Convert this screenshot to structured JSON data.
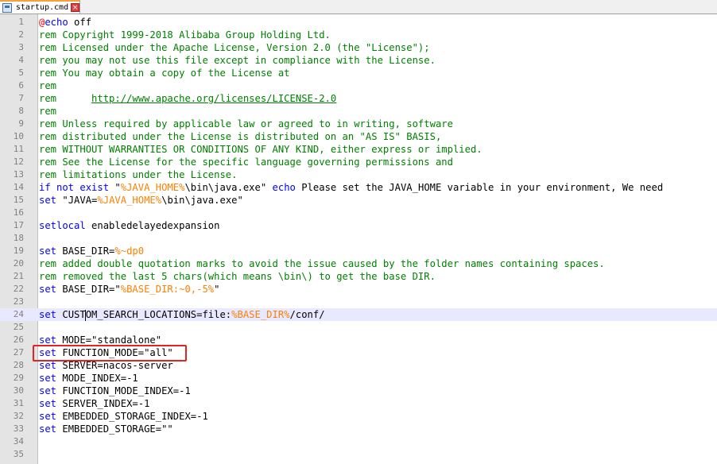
{
  "tab": {
    "filename": "startup.cmd",
    "close_glyph": "×",
    "icon": "file-icon"
  },
  "editor": {
    "current_line": 24,
    "lines": [
      {
        "n": "1",
        "segs": [
          {
            "c": "at",
            "t": "@"
          },
          {
            "c": "kw",
            "t": "echo"
          },
          {
            "c": "",
            "t": " off"
          }
        ]
      },
      {
        "n": "2",
        "segs": [
          {
            "c": "rem",
            "t": "rem Copyright 1999-2018 Alibaba Group Holding Ltd."
          }
        ]
      },
      {
        "n": "3",
        "segs": [
          {
            "c": "rem",
            "t": "rem Licensed under the Apache License, Version 2.0 (the \"License\");"
          }
        ]
      },
      {
        "n": "4",
        "segs": [
          {
            "c": "rem",
            "t": "rem you may not use this file except in compliance with the License."
          }
        ]
      },
      {
        "n": "5",
        "segs": [
          {
            "c": "rem",
            "t": "rem You may obtain a copy of the License at"
          }
        ]
      },
      {
        "n": "6",
        "segs": [
          {
            "c": "rem",
            "t": "rem"
          }
        ]
      },
      {
        "n": "7",
        "segs": [
          {
            "c": "rem",
            "t": "rem      "
          },
          {
            "c": "url",
            "t": "http://www.apache.org/licenses/LICENSE-2.0"
          }
        ]
      },
      {
        "n": "8",
        "segs": [
          {
            "c": "rem",
            "t": "rem"
          }
        ]
      },
      {
        "n": "9",
        "segs": [
          {
            "c": "rem",
            "t": "rem Unless required by applicable law or agreed to in writing, software"
          }
        ]
      },
      {
        "n": "10",
        "segs": [
          {
            "c": "rem",
            "t": "rem distributed under the License is distributed on an \"AS IS\" BASIS,"
          }
        ]
      },
      {
        "n": "11",
        "segs": [
          {
            "c": "rem",
            "t": "rem WITHOUT WARRANTIES OR CONDITIONS OF ANY KIND, either express or implied."
          }
        ]
      },
      {
        "n": "12",
        "segs": [
          {
            "c": "rem",
            "t": "rem See the License for the specific language governing permissions and"
          }
        ]
      },
      {
        "n": "13",
        "segs": [
          {
            "c": "rem",
            "t": "rem limitations under the License."
          }
        ]
      },
      {
        "n": "14",
        "segs": [
          {
            "c": "kw",
            "t": "if not exist"
          },
          {
            "c": "",
            "t": " \""
          },
          {
            "c": "var",
            "t": "%JAVA_HOME%"
          },
          {
            "c": "",
            "t": "\\bin\\java.exe\" "
          },
          {
            "c": "kw",
            "t": "echo"
          },
          {
            "c": "",
            "t": " Please set the JAVA_HOME variable in your environment, We need"
          }
        ]
      },
      {
        "n": "15",
        "segs": [
          {
            "c": "kw",
            "t": "set"
          },
          {
            "c": "",
            "t": " \"JAVA="
          },
          {
            "c": "var",
            "t": "%JAVA_HOME%"
          },
          {
            "c": "",
            "t": "\\bin\\java.exe\""
          }
        ]
      },
      {
        "n": "16",
        "segs": []
      },
      {
        "n": "17",
        "segs": [
          {
            "c": "kw",
            "t": "setlocal"
          },
          {
            "c": "",
            "t": " enabledelayedexpansion"
          }
        ]
      },
      {
        "n": "18",
        "segs": []
      },
      {
        "n": "19",
        "segs": [
          {
            "c": "kw",
            "t": "set"
          },
          {
            "c": "",
            "t": " BASE_DIR="
          },
          {
            "c": "var",
            "t": "%~dp0"
          }
        ]
      },
      {
        "n": "20",
        "segs": [
          {
            "c": "rem",
            "t": "rem added double quotation marks to avoid the issue caused by the folder names containing spaces."
          }
        ]
      },
      {
        "n": "21",
        "segs": [
          {
            "c": "rem",
            "t": "rem removed the last 5 chars(which means \\bin\\) to get the base DIR."
          }
        ]
      },
      {
        "n": "22",
        "segs": [
          {
            "c": "kw",
            "t": "set"
          },
          {
            "c": "",
            "t": " BASE_DIR=\""
          },
          {
            "c": "var",
            "t": "%BASE_DIR:~0,-5%"
          },
          {
            "c": "",
            "t": "\""
          }
        ]
      },
      {
        "n": "23",
        "segs": []
      },
      {
        "n": "24",
        "segs": [
          {
            "c": "kw",
            "t": "set"
          },
          {
            "c": "",
            "t": " CUST"
          },
          {
            "c": "caret",
            "t": ""
          },
          {
            "c": "",
            "t": "OM_SEARCH_LOCATIONS=file:"
          },
          {
            "c": "var",
            "t": "%BASE_DIR%"
          },
          {
            "c": "",
            "t": "/conf/"
          }
        ]
      },
      {
        "n": "25",
        "segs": []
      },
      {
        "n": "26",
        "segs": [
          {
            "c": "kw",
            "t": "set"
          },
          {
            "c": "",
            "t": " MODE=\"standalone\""
          }
        ]
      },
      {
        "n": "27",
        "segs": [
          {
            "c": "kw",
            "t": "set"
          },
          {
            "c": "",
            "t": " FUNCTION_MODE=\"all\""
          }
        ]
      },
      {
        "n": "28",
        "segs": [
          {
            "c": "kw",
            "t": "set"
          },
          {
            "c": "",
            "t": " SERVER=nacos-server"
          }
        ]
      },
      {
        "n": "29",
        "segs": [
          {
            "c": "kw",
            "t": "set"
          },
          {
            "c": "",
            "t": " MODE_INDEX=-1"
          }
        ]
      },
      {
        "n": "30",
        "segs": [
          {
            "c": "kw",
            "t": "set"
          },
          {
            "c": "",
            "t": " FUNCTION_MODE_INDEX=-1"
          }
        ]
      },
      {
        "n": "31",
        "segs": [
          {
            "c": "kw",
            "t": "set"
          },
          {
            "c": "",
            "t": " SERVER_INDEX=-1"
          }
        ]
      },
      {
        "n": "32",
        "segs": [
          {
            "c": "kw",
            "t": "set"
          },
          {
            "c": "",
            "t": " EMBEDDED_STORAGE_INDEX=-1"
          }
        ]
      },
      {
        "n": "33",
        "segs": [
          {
            "c": "kw",
            "t": "set"
          },
          {
            "c": "",
            "t": " EMBEDDED_STORAGE=\"\""
          }
        ]
      },
      {
        "n": "34",
        "segs": []
      },
      {
        "n": "35",
        "segs": []
      }
    ]
  },
  "colors": {
    "keyword": "#0000ff",
    "comment": "#008000",
    "variable": "#ff8000",
    "highlight_box": "#e32222"
  }
}
